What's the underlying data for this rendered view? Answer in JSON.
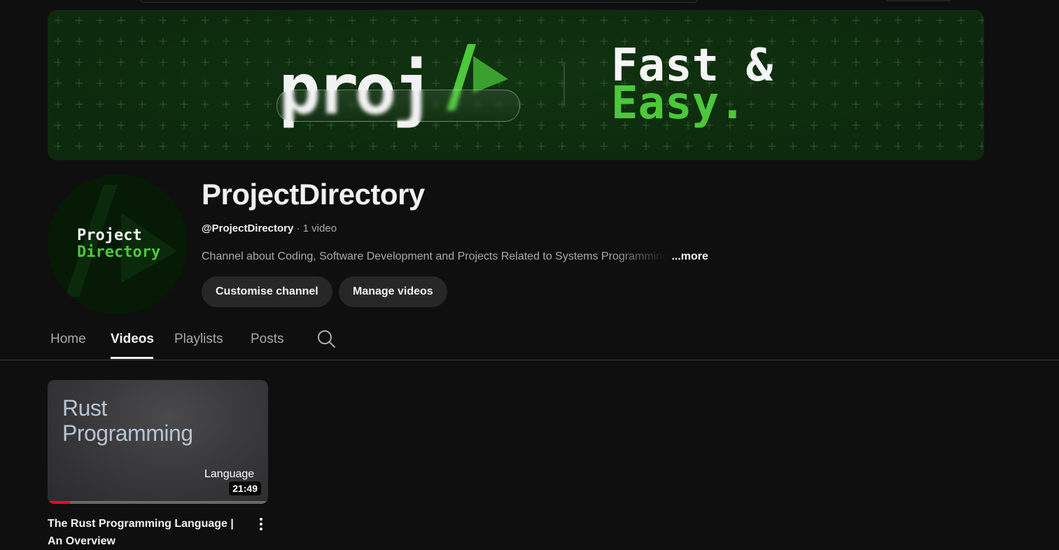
{
  "banner": {
    "logo_text": "proj",
    "tagline_line1": "Fast &",
    "tagline_line2": "Easy.",
    "accent_color": "#4cc83a"
  },
  "channel": {
    "avatar_line1": "Project",
    "avatar_line2": "Directory",
    "name": "ProjectDirectory",
    "handle": "@ProjectDirectory",
    "meta": " · 1 video",
    "description": "Channel about Coding, Software Development and Projects Related to Systems Programming",
    "more_label": "...more",
    "customise_label": "Customise channel",
    "manage_label": "Manage videos"
  },
  "tabs": [
    {
      "label": "Home",
      "active": false
    },
    {
      "label": "Videos",
      "active": true
    },
    {
      "label": "Playlists",
      "active": false
    },
    {
      "label": "Posts",
      "active": false
    }
  ],
  "search_icon": "search-icon",
  "videos": [
    {
      "thumb_title_line1": "Rust",
      "thumb_title_line2": "Programming",
      "thumb_subtitle": "Language",
      "duration": "21:49",
      "watched_fraction": 0.1,
      "title": "The Rust Programming Language | An Overview",
      "more_icon": "more-vert-icon"
    }
  ]
}
